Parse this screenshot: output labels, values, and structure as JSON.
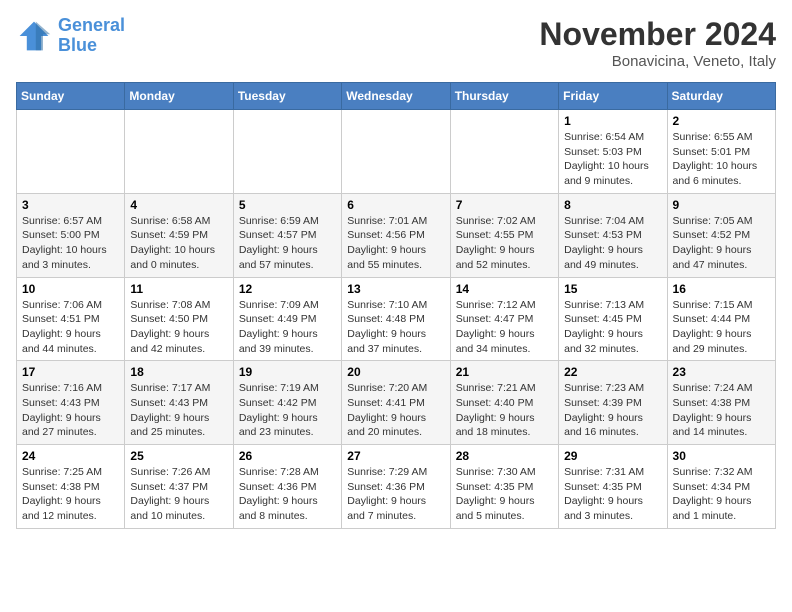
{
  "header": {
    "logo_general": "General",
    "logo_blue": "Blue",
    "month_title": "November 2024",
    "subtitle": "Bonavicina, Veneto, Italy"
  },
  "weekdays": [
    "Sunday",
    "Monday",
    "Tuesday",
    "Wednesday",
    "Thursday",
    "Friday",
    "Saturday"
  ],
  "weeks": [
    [
      {
        "day": "",
        "info": ""
      },
      {
        "day": "",
        "info": ""
      },
      {
        "day": "",
        "info": ""
      },
      {
        "day": "",
        "info": ""
      },
      {
        "day": "",
        "info": ""
      },
      {
        "day": "1",
        "info": "Sunrise: 6:54 AM\nSunset: 5:03 PM\nDaylight: 10 hours and 9 minutes."
      },
      {
        "day": "2",
        "info": "Sunrise: 6:55 AM\nSunset: 5:01 PM\nDaylight: 10 hours and 6 minutes."
      }
    ],
    [
      {
        "day": "3",
        "info": "Sunrise: 6:57 AM\nSunset: 5:00 PM\nDaylight: 10 hours and 3 minutes."
      },
      {
        "day": "4",
        "info": "Sunrise: 6:58 AM\nSunset: 4:59 PM\nDaylight: 10 hours and 0 minutes."
      },
      {
        "day": "5",
        "info": "Sunrise: 6:59 AM\nSunset: 4:57 PM\nDaylight: 9 hours and 57 minutes."
      },
      {
        "day": "6",
        "info": "Sunrise: 7:01 AM\nSunset: 4:56 PM\nDaylight: 9 hours and 55 minutes."
      },
      {
        "day": "7",
        "info": "Sunrise: 7:02 AM\nSunset: 4:55 PM\nDaylight: 9 hours and 52 minutes."
      },
      {
        "day": "8",
        "info": "Sunrise: 7:04 AM\nSunset: 4:53 PM\nDaylight: 9 hours and 49 minutes."
      },
      {
        "day": "9",
        "info": "Sunrise: 7:05 AM\nSunset: 4:52 PM\nDaylight: 9 hours and 47 minutes."
      }
    ],
    [
      {
        "day": "10",
        "info": "Sunrise: 7:06 AM\nSunset: 4:51 PM\nDaylight: 9 hours and 44 minutes."
      },
      {
        "day": "11",
        "info": "Sunrise: 7:08 AM\nSunset: 4:50 PM\nDaylight: 9 hours and 42 minutes."
      },
      {
        "day": "12",
        "info": "Sunrise: 7:09 AM\nSunset: 4:49 PM\nDaylight: 9 hours and 39 minutes."
      },
      {
        "day": "13",
        "info": "Sunrise: 7:10 AM\nSunset: 4:48 PM\nDaylight: 9 hours and 37 minutes."
      },
      {
        "day": "14",
        "info": "Sunrise: 7:12 AM\nSunset: 4:47 PM\nDaylight: 9 hours and 34 minutes."
      },
      {
        "day": "15",
        "info": "Sunrise: 7:13 AM\nSunset: 4:45 PM\nDaylight: 9 hours and 32 minutes."
      },
      {
        "day": "16",
        "info": "Sunrise: 7:15 AM\nSunset: 4:44 PM\nDaylight: 9 hours and 29 minutes."
      }
    ],
    [
      {
        "day": "17",
        "info": "Sunrise: 7:16 AM\nSunset: 4:43 PM\nDaylight: 9 hours and 27 minutes."
      },
      {
        "day": "18",
        "info": "Sunrise: 7:17 AM\nSunset: 4:43 PM\nDaylight: 9 hours and 25 minutes."
      },
      {
        "day": "19",
        "info": "Sunrise: 7:19 AM\nSunset: 4:42 PM\nDaylight: 9 hours and 23 minutes."
      },
      {
        "day": "20",
        "info": "Sunrise: 7:20 AM\nSunset: 4:41 PM\nDaylight: 9 hours and 20 minutes."
      },
      {
        "day": "21",
        "info": "Sunrise: 7:21 AM\nSunset: 4:40 PM\nDaylight: 9 hours and 18 minutes."
      },
      {
        "day": "22",
        "info": "Sunrise: 7:23 AM\nSunset: 4:39 PM\nDaylight: 9 hours and 16 minutes."
      },
      {
        "day": "23",
        "info": "Sunrise: 7:24 AM\nSunset: 4:38 PM\nDaylight: 9 hours and 14 minutes."
      }
    ],
    [
      {
        "day": "24",
        "info": "Sunrise: 7:25 AM\nSunset: 4:38 PM\nDaylight: 9 hours and 12 minutes."
      },
      {
        "day": "25",
        "info": "Sunrise: 7:26 AM\nSunset: 4:37 PM\nDaylight: 9 hours and 10 minutes."
      },
      {
        "day": "26",
        "info": "Sunrise: 7:28 AM\nSunset: 4:36 PM\nDaylight: 9 hours and 8 minutes."
      },
      {
        "day": "27",
        "info": "Sunrise: 7:29 AM\nSunset: 4:36 PM\nDaylight: 9 hours and 7 minutes."
      },
      {
        "day": "28",
        "info": "Sunrise: 7:30 AM\nSunset: 4:35 PM\nDaylight: 9 hours and 5 minutes."
      },
      {
        "day": "29",
        "info": "Sunrise: 7:31 AM\nSunset: 4:35 PM\nDaylight: 9 hours and 3 minutes."
      },
      {
        "day": "30",
        "info": "Sunrise: 7:32 AM\nSunset: 4:34 PM\nDaylight: 9 hours and 1 minute."
      }
    ]
  ]
}
